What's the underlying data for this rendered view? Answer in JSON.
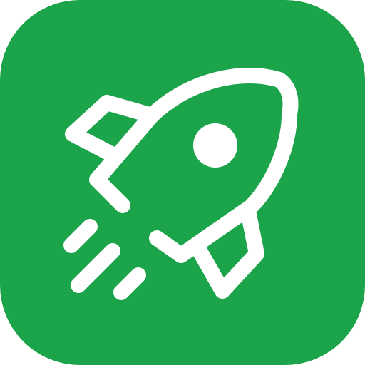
{
  "app_icon": {
    "icon": "rocket-icon",
    "background_color": "#1BA44A",
    "glyph_color": "#FFFFFF"
  }
}
